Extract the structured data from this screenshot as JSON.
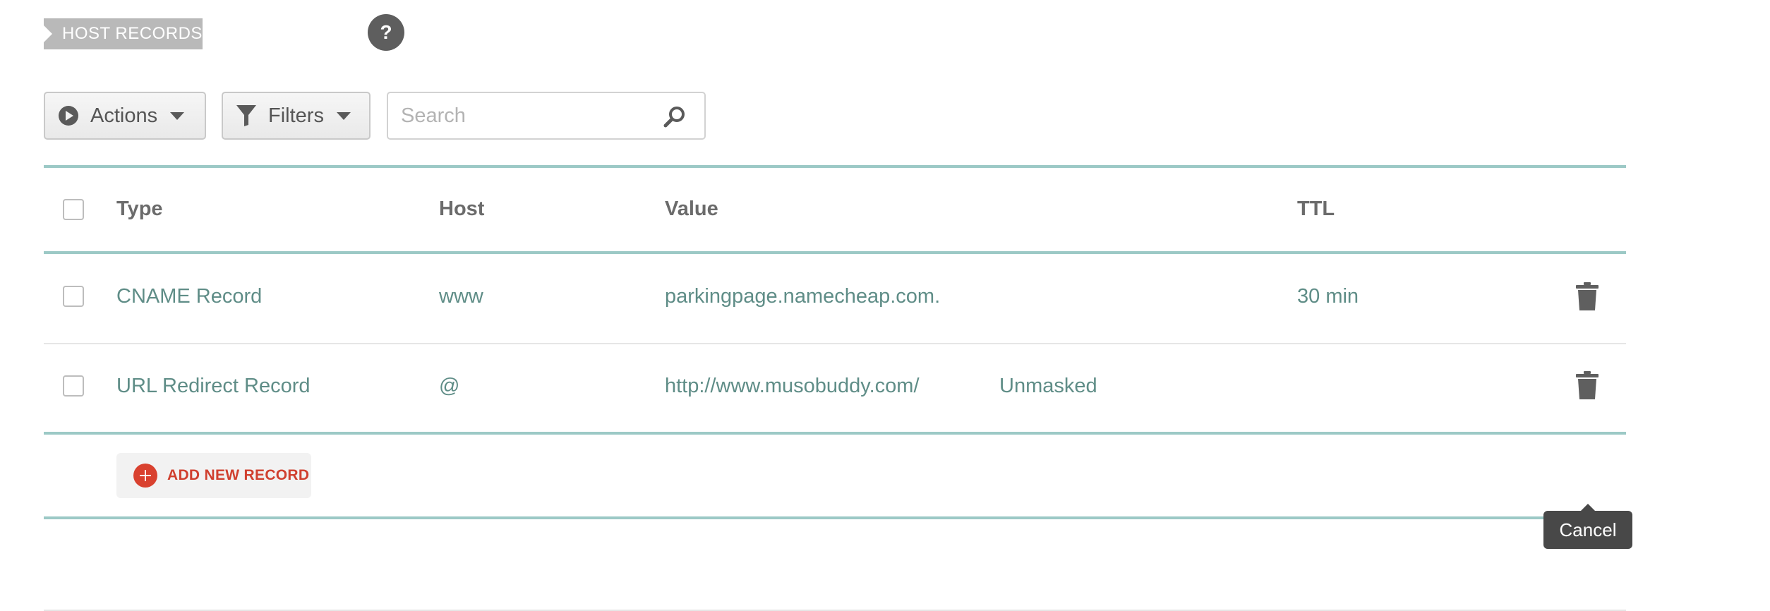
{
  "section": {
    "title": "HOST RECORDS",
    "help_label": "?"
  },
  "toolbar": {
    "actions_label": "Actions",
    "filters_label": "Filters",
    "search_placeholder": "Search"
  },
  "table": {
    "headers": {
      "type": "Type",
      "host": "Host",
      "value": "Value",
      "ttl": "TTL"
    },
    "rows": [
      {
        "type": "CNAME Record",
        "host": "www",
        "value": "parkingpage.namecheap.com.",
        "extra": "",
        "ttl": "30 min"
      },
      {
        "type": "URL Redirect Record",
        "host": "@",
        "value": "http://www.musobuddy.com/",
        "extra": "Unmasked",
        "ttl": ""
      }
    ]
  },
  "add_record": {
    "label": "ADD NEW RECORD"
  },
  "tooltip": {
    "text": "Cancel"
  },
  "colors": {
    "accent_teal": "#9cc9c6",
    "link_text": "#5f8d87",
    "add_red": "#d0402f",
    "tag_gray": "#b9b9b9"
  },
  "icons": {
    "actions": "play-circle-icon",
    "filters": "funnel-icon",
    "search": "search-icon",
    "delete": "trash-icon",
    "add": "plus-circle-icon"
  }
}
